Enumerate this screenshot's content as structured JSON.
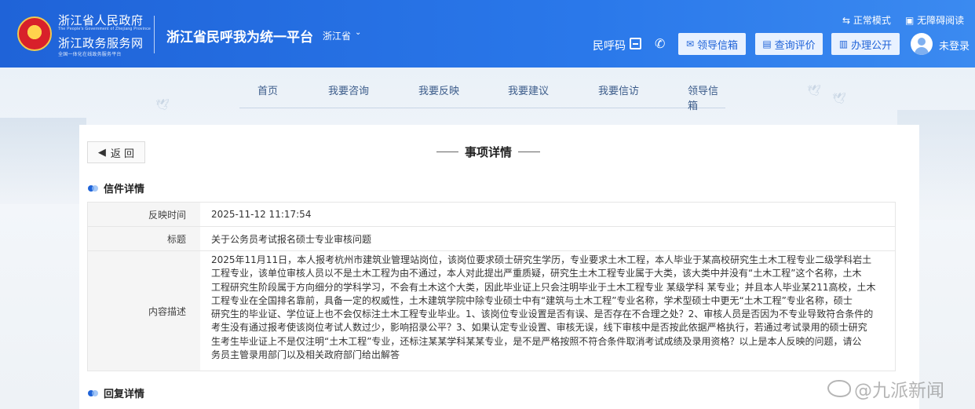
{
  "header": {
    "gov_title": "浙江省人民政府",
    "gov_subtitle": "The People's Government of Zhejiang Province",
    "service_title": "浙江政务服务网",
    "service_subtitle": "全国一体化在线政务服务平台",
    "platform_title": "浙江省民呼我为统一平台",
    "province": "浙江省",
    "mode_normal": "正常模式",
    "mode_accessible": "无障碍阅读",
    "hotline_code": "民呼码",
    "buttons": {
      "leader_mailbox": "领导信箱",
      "query_review": "查询评价",
      "affairs_public": "办理公开"
    },
    "login": "未登录"
  },
  "nav": {
    "items": [
      "首页",
      "我要咨询",
      "我要反映",
      "我要建议",
      "我要信访",
      "领导信箱"
    ]
  },
  "content": {
    "back_label": "返 回",
    "page_title": "事项详情",
    "letter_section": "信件详情",
    "reply_section": "回复详情",
    "fields": {
      "time_label": "反映时间",
      "time_value": "2025-11-12 11:17:54",
      "title_label": "标题",
      "title_value": "关于公务员考试报名硕士专业审核问题",
      "desc_label": "内容描述",
      "desc_lines": [
        "2025年11月11日，本人报考杭州市建筑业管理站岗位，该岗位要求硕士研究生学历，专业要求土木工程，本人毕业于某高校研究生土木工程专业二级学科岩土",
        "工程专业，该单位审核人员以不是土木工程为由不通过，本人对此提出严重质疑，研究生土木工程专业属于大类，该大类中并没有“土木工程”这个名称，土木",
        "工程研究生阶段属于方向细分的学科学习，不会有土木这个大类，因此毕业证上只会注明毕业于土木工程专业 某级学科 某专业；并且本人毕业某211高校，土木",
        "工程专业在全国排名靠前，具备一定的权威性，土木建筑学院中除专业硕士中有“建筑与土木工程”专业名称，学术型硕士中更无“土木工程”专业名称，硕士",
        "研究生的毕业证、学位证上也不会仅标注土木工程专业毕业。1、该岗位专业设置是否有误、是否存在不合理之处？2、审核人员是否因为不专业导致符合条件的",
        "考生没有通过报考使该岗位考试人数过少，影响招录公平？3、如果认定专业设置、审核无误，线下审核中是否按此依据严格执行，若通过考试录用的硕士研究",
        "生考生毕业证上不是仅注明“土木工程”专业，还标注某某学科某某专业，是不是严格按照不符合条件取消考试成绩及录用资格？以上是本人反映的问题，请公",
        "务员主管录用部门以及相关政府部门给出解答"
      ]
    }
  },
  "watermark": "@九派新闻",
  "colors": {
    "header_blue": "#1f63d8",
    "accent_blue": "#1f63d8",
    "panel_bg": "#ffffff"
  }
}
